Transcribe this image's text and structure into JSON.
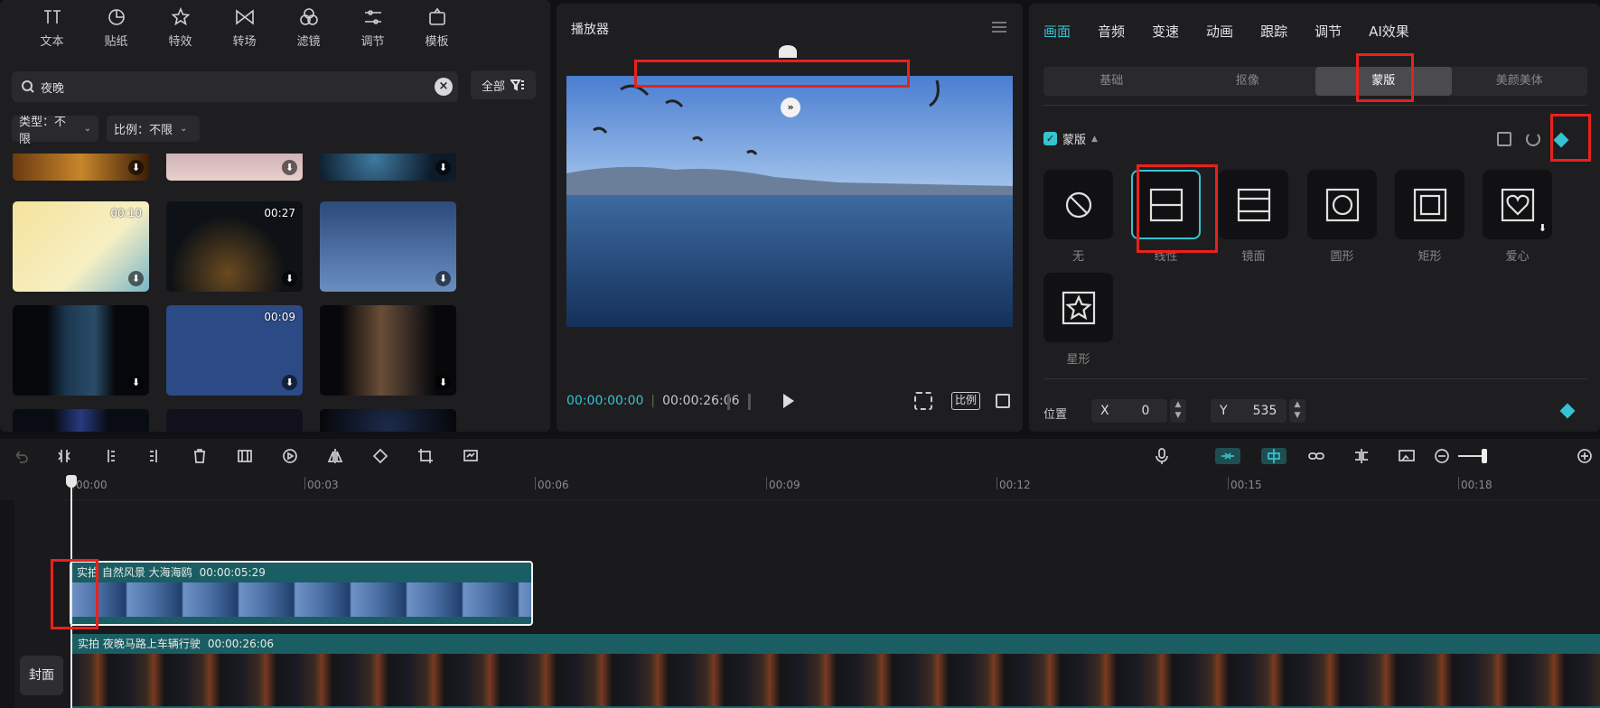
{
  "left_toolbar": [
    {
      "label": "文本",
      "icon": "text-icon"
    },
    {
      "label": "贴纸",
      "icon": "sticker-icon"
    },
    {
      "label": "特效",
      "icon": "effects-icon"
    },
    {
      "label": "转场",
      "icon": "transition-icon"
    },
    {
      "label": "滤镜",
      "icon": "filter-icon"
    },
    {
      "label": "调节",
      "icon": "adjust-icon"
    },
    {
      "label": "模板",
      "icon": "template-icon"
    }
  ],
  "search": {
    "value": "夜晚"
  },
  "all_button": "全部",
  "filters": {
    "type_label": "类型：不限",
    "ratio_label": "比例：不限"
  },
  "thumbnails": [
    {
      "duration": ""
    },
    {
      "duration": ""
    },
    {
      "duration": ""
    },
    {
      "duration": "00:10"
    },
    {
      "duration": "00:27"
    },
    {
      "duration": ""
    },
    {
      "duration": ""
    },
    {
      "duration": "00:09"
    },
    {
      "duration": ""
    },
    {
      "duration": ""
    },
    {
      "duration": ""
    },
    {
      "duration": ""
    }
  ],
  "player": {
    "title": "播放器",
    "current_time": "00:00:00:00",
    "total_time": "00:00:26:06",
    "ratio_label": "比例"
  },
  "inspector": {
    "tabs": [
      "画面",
      "音频",
      "变速",
      "动画",
      "跟踪",
      "调节",
      "AI效果"
    ],
    "active_tab": "画面",
    "subtabs": [
      "基础",
      "抠像",
      "蒙版",
      "美颜美体"
    ],
    "active_subtab": "蒙版",
    "mask_section_label": "蒙版",
    "masks": [
      {
        "name": "无",
        "icon": "none-mask-icon"
      },
      {
        "name": "线性",
        "icon": "linear-mask-icon"
      },
      {
        "name": "镜面",
        "icon": "mirror-mask-icon"
      },
      {
        "name": "圆形",
        "icon": "circle-mask-icon"
      },
      {
        "name": "矩形",
        "icon": "rectangle-mask-icon"
      },
      {
        "name": "爱心",
        "icon": "heart-mask-icon"
      },
      {
        "name": "星形",
        "icon": "star-mask-icon"
      }
    ],
    "selected_mask": "线性",
    "position_label": "位置",
    "x_label": "X",
    "x_value": "0",
    "y_label": "Y",
    "y_value": "535"
  },
  "timeline": {
    "ruler_ticks": [
      "00:00",
      "00:03",
      "00:06",
      "00:09",
      "00:12",
      "00:15",
      "00:18"
    ],
    "clip1": {
      "name": "实拍 自然风景 大海海鸥",
      "duration": "00:00:05:29"
    },
    "clip2": {
      "name": "实拍 夜晚马路上车辆行驶",
      "duration": "00:00:26:06"
    },
    "cover_label": "封面"
  },
  "colors": {
    "accent": "#35c3d2",
    "annotation": "#e8211d",
    "clip": "#1a5e63"
  }
}
